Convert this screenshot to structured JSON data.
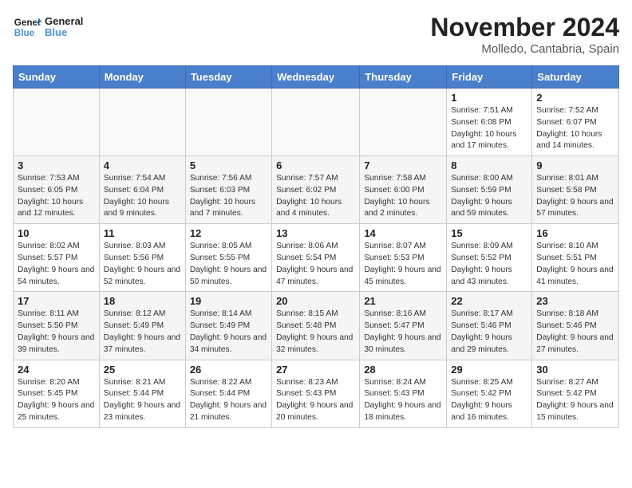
{
  "header": {
    "logo_text_general": "General",
    "logo_text_blue": "Blue",
    "month_year": "November 2024",
    "location": "Molledo, Cantabria, Spain"
  },
  "weekdays": [
    "Sunday",
    "Monday",
    "Tuesday",
    "Wednesday",
    "Thursday",
    "Friday",
    "Saturday"
  ],
  "weeks": [
    [
      {
        "day": "",
        "info": ""
      },
      {
        "day": "",
        "info": ""
      },
      {
        "day": "",
        "info": ""
      },
      {
        "day": "",
        "info": ""
      },
      {
        "day": "",
        "info": ""
      },
      {
        "day": "1",
        "info": "Sunrise: 7:51 AM\nSunset: 6:08 PM\nDaylight: 10 hours and 17 minutes."
      },
      {
        "day": "2",
        "info": "Sunrise: 7:52 AM\nSunset: 6:07 PM\nDaylight: 10 hours and 14 minutes."
      }
    ],
    [
      {
        "day": "3",
        "info": "Sunrise: 7:53 AM\nSunset: 6:05 PM\nDaylight: 10 hours and 12 minutes."
      },
      {
        "day": "4",
        "info": "Sunrise: 7:54 AM\nSunset: 6:04 PM\nDaylight: 10 hours and 9 minutes."
      },
      {
        "day": "5",
        "info": "Sunrise: 7:56 AM\nSunset: 6:03 PM\nDaylight: 10 hours and 7 minutes."
      },
      {
        "day": "6",
        "info": "Sunrise: 7:57 AM\nSunset: 6:02 PM\nDaylight: 10 hours and 4 minutes."
      },
      {
        "day": "7",
        "info": "Sunrise: 7:58 AM\nSunset: 6:00 PM\nDaylight: 10 hours and 2 minutes."
      },
      {
        "day": "8",
        "info": "Sunrise: 8:00 AM\nSunset: 5:59 PM\nDaylight: 9 hours and 59 minutes."
      },
      {
        "day": "9",
        "info": "Sunrise: 8:01 AM\nSunset: 5:58 PM\nDaylight: 9 hours and 57 minutes."
      }
    ],
    [
      {
        "day": "10",
        "info": "Sunrise: 8:02 AM\nSunset: 5:57 PM\nDaylight: 9 hours and 54 minutes."
      },
      {
        "day": "11",
        "info": "Sunrise: 8:03 AM\nSunset: 5:56 PM\nDaylight: 9 hours and 52 minutes."
      },
      {
        "day": "12",
        "info": "Sunrise: 8:05 AM\nSunset: 5:55 PM\nDaylight: 9 hours and 50 minutes."
      },
      {
        "day": "13",
        "info": "Sunrise: 8:06 AM\nSunset: 5:54 PM\nDaylight: 9 hours and 47 minutes."
      },
      {
        "day": "14",
        "info": "Sunrise: 8:07 AM\nSunset: 5:53 PM\nDaylight: 9 hours and 45 minutes."
      },
      {
        "day": "15",
        "info": "Sunrise: 8:09 AM\nSunset: 5:52 PM\nDaylight: 9 hours and 43 minutes."
      },
      {
        "day": "16",
        "info": "Sunrise: 8:10 AM\nSunset: 5:51 PM\nDaylight: 9 hours and 41 minutes."
      }
    ],
    [
      {
        "day": "17",
        "info": "Sunrise: 8:11 AM\nSunset: 5:50 PM\nDaylight: 9 hours and 39 minutes."
      },
      {
        "day": "18",
        "info": "Sunrise: 8:12 AM\nSunset: 5:49 PM\nDaylight: 9 hours and 37 minutes."
      },
      {
        "day": "19",
        "info": "Sunrise: 8:14 AM\nSunset: 5:49 PM\nDaylight: 9 hours and 34 minutes."
      },
      {
        "day": "20",
        "info": "Sunrise: 8:15 AM\nSunset: 5:48 PM\nDaylight: 9 hours and 32 minutes."
      },
      {
        "day": "21",
        "info": "Sunrise: 8:16 AM\nSunset: 5:47 PM\nDaylight: 9 hours and 30 minutes."
      },
      {
        "day": "22",
        "info": "Sunrise: 8:17 AM\nSunset: 5:46 PM\nDaylight: 9 hours and 29 minutes."
      },
      {
        "day": "23",
        "info": "Sunrise: 8:18 AM\nSunset: 5:46 PM\nDaylight: 9 hours and 27 minutes."
      }
    ],
    [
      {
        "day": "24",
        "info": "Sunrise: 8:20 AM\nSunset: 5:45 PM\nDaylight: 9 hours and 25 minutes."
      },
      {
        "day": "25",
        "info": "Sunrise: 8:21 AM\nSunset: 5:44 PM\nDaylight: 9 hours and 23 minutes."
      },
      {
        "day": "26",
        "info": "Sunrise: 8:22 AM\nSunset: 5:44 PM\nDaylight: 9 hours and 21 minutes."
      },
      {
        "day": "27",
        "info": "Sunrise: 8:23 AM\nSunset: 5:43 PM\nDaylight: 9 hours and 20 minutes."
      },
      {
        "day": "28",
        "info": "Sunrise: 8:24 AM\nSunset: 5:43 PM\nDaylight: 9 hours and 18 minutes."
      },
      {
        "day": "29",
        "info": "Sunrise: 8:25 AM\nSunset: 5:42 PM\nDaylight: 9 hours and 16 minutes."
      },
      {
        "day": "30",
        "info": "Sunrise: 8:27 AM\nSunset: 5:42 PM\nDaylight: 9 hours and 15 minutes."
      }
    ]
  ]
}
